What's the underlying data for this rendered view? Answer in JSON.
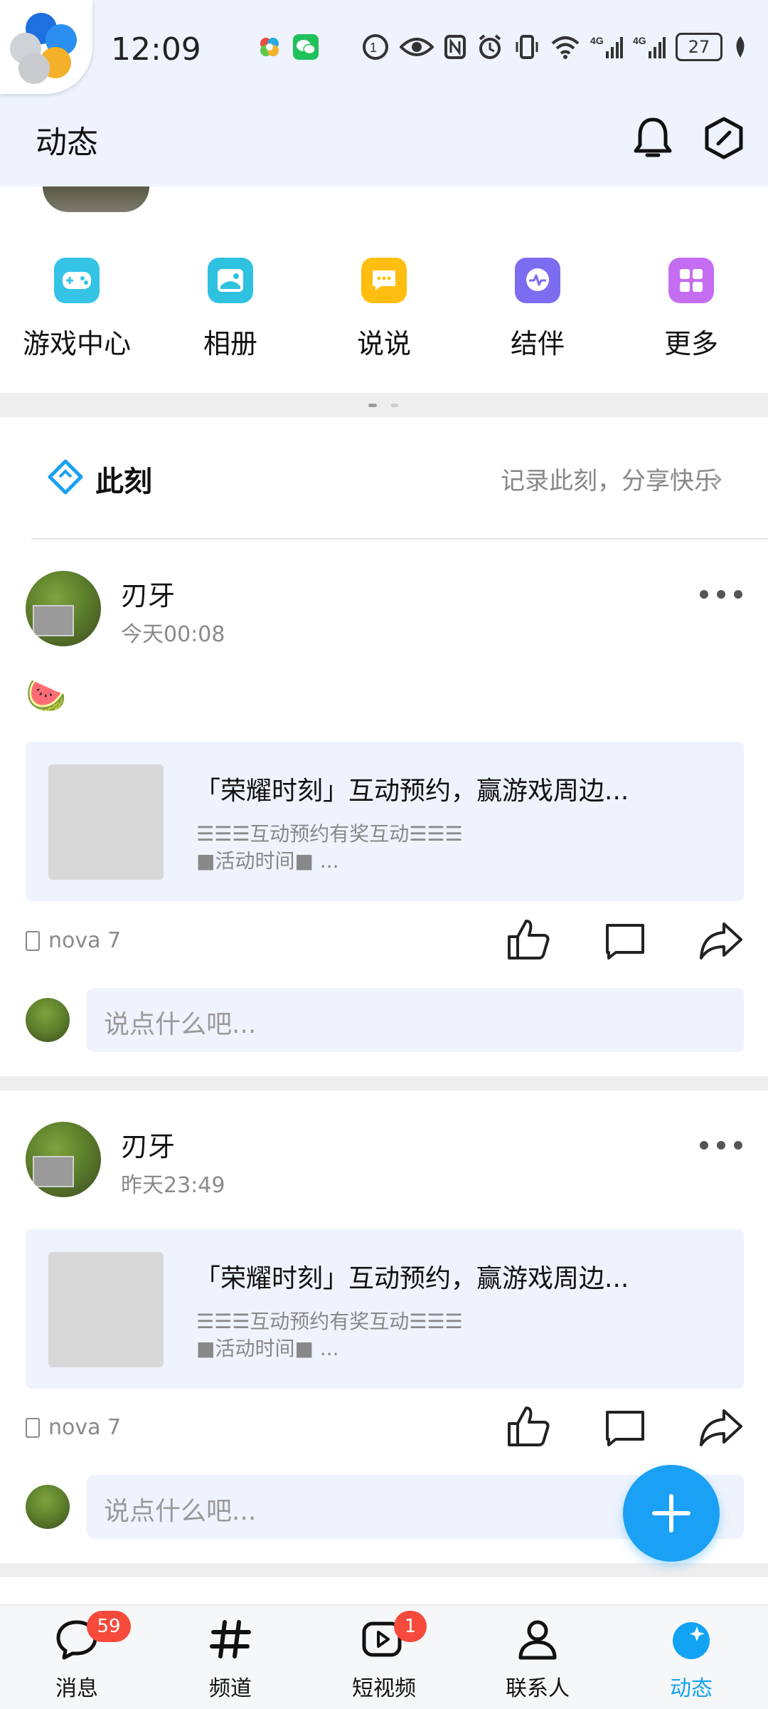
{
  "status_bar": {
    "time": "12:09",
    "battery": "27",
    "icons": [
      "colorful-app-icon",
      "wechat-icon",
      "nfc-icon",
      "eye-icon",
      "alarm-icon",
      "vibrate-icon",
      "wifi-icon",
      "signal-4g-icon",
      "signal-4g-icon",
      "leaf-icon"
    ]
  },
  "header": {
    "title": "动态",
    "icons": [
      "bell-icon",
      "hexagon-icon"
    ]
  },
  "shortcuts": [
    {
      "label": "游戏中心",
      "color": "#35c3e6",
      "icon": "gamepad-icon"
    },
    {
      "label": "相册",
      "color": "#2fc2e0",
      "icon": "photo-icon"
    },
    {
      "label": "说说",
      "color": "#ffbe10",
      "icon": "chat-bubble-icon"
    },
    {
      "label": "结伴",
      "color": "#7b6cf0",
      "icon": "pulse-chat-icon"
    },
    {
      "label": "更多",
      "color": "#c56df0",
      "icon": "grid-icon"
    }
  ],
  "moment": {
    "title": "此刻",
    "subtitle": "记录此刻，分享快乐",
    "arrow": "›"
  },
  "posts": [
    {
      "author": "刃牙",
      "time": "今天00:08",
      "emoji": "🍉",
      "card_title": "「荣耀时刻」互动预约，赢游戏周边...",
      "card_desc_1": "☰☰☰互动预约有奖互动☰☰☰",
      "card_desc_2": "■活动时间■   ...",
      "device": "nova 7",
      "comment_placeholder": "说点什么吧..."
    },
    {
      "author": "刃牙",
      "time": "昨天23:49",
      "card_title": "「荣耀时刻」互动预约，赢游戏周边...",
      "card_desc_1": "☰☰☰互动预约有奖互动☰☰☰",
      "card_desc_2": "■活动时间■   ...",
      "device": "nova 7",
      "comment_placeholder": "说点什么吧..."
    }
  ],
  "tabs": [
    {
      "label": "消息",
      "badge": "59",
      "icon": "message-icon"
    },
    {
      "label": "频道",
      "icon": "hashtag-icon"
    },
    {
      "label": "短视频",
      "badge": "1",
      "icon": "video-icon"
    },
    {
      "label": "联系人",
      "icon": "person-icon"
    },
    {
      "label": "动态",
      "icon": "star-planet-icon",
      "active": true,
      "color": "#12a3f5"
    }
  ],
  "colors": {
    "header_bg": "#eef3fd",
    "accent": "#1aa0f5",
    "badge": "#f64b3c"
  }
}
